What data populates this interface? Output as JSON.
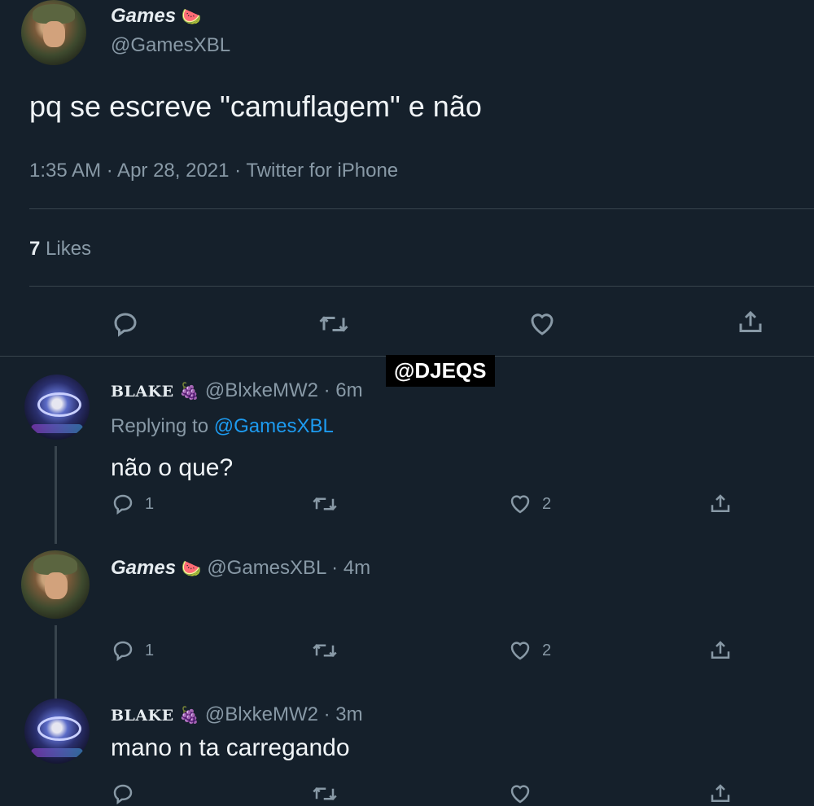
{
  "main_tweet": {
    "author_name": "Games",
    "author_emoji": "🍉",
    "handle": "@GamesXBL",
    "text": "pq se escreve \"camuflagem\" e não",
    "meta": "1:35 AM · Apr 28, 2021 · Twitter for iPhone",
    "likes_count": "7",
    "likes_label": "Likes"
  },
  "watermark": "@DJEQS",
  "replies": [
    {
      "author_name": "BLAKE",
      "author_emoji": "🍇",
      "handle_time": "@BlxkeMW2 · 6m",
      "replying_prefix": "Replying to",
      "replying_handle": "@GamesXBL",
      "text": "não o que?",
      "reply_count": "1",
      "like_count": "2"
    },
    {
      "author_name": "Games",
      "author_emoji": "🍉",
      "handle_time": "@GamesXBL · 4m",
      "reply_count": "1",
      "like_count": "2"
    },
    {
      "author_name": "BLAKE",
      "author_emoji": "🍇",
      "handle_time": "@BlxkeMW2 · 3m",
      "text": "mano n ta carregando"
    }
  ],
  "icons": {
    "reply": "reply-icon",
    "retweet": "retweet-icon",
    "like": "heart-icon",
    "share": "share-icon"
  },
  "colors": {
    "background": "#15202b",
    "text": "#e6ecf0",
    "secondary": "#8899a6",
    "link": "#1d9bf0",
    "divider": "#38444d"
  }
}
